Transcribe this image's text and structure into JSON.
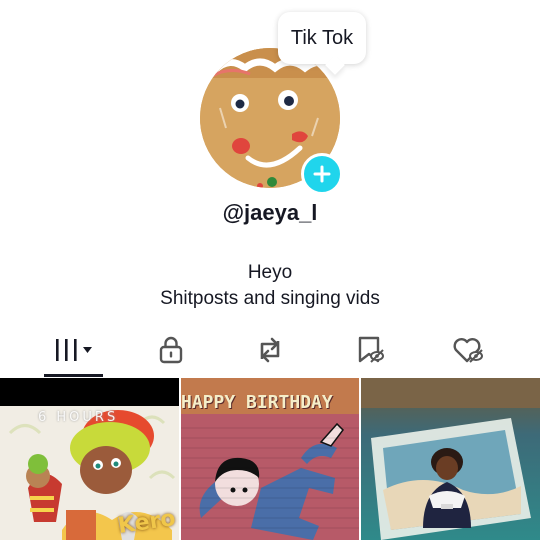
{
  "tooltip": {
    "text": "Tik Tok"
  },
  "profile": {
    "username": "@jaeya_l",
    "bio_line1": "Heyo",
    "bio_line2": "Shitposts and singing vids"
  },
  "tabs": [
    {
      "icon": "grid-icon",
      "selected": true
    },
    {
      "icon": "lock-icon"
    },
    {
      "icon": "repost-icon"
    },
    {
      "icon": "bookmark-hidden-icon"
    },
    {
      "icon": "liked-hidden-icon"
    }
  ],
  "videos": [
    {
      "overlay_text": "6 HOURS",
      "caption": "Kero"
    },
    {
      "overlay_text": "HAPPY BIRTHDAY"
    },
    {
      "overlay_text": ""
    }
  ],
  "colors": {
    "accent": "#20d5ec",
    "text": "#161823",
    "icon": "#555555"
  }
}
